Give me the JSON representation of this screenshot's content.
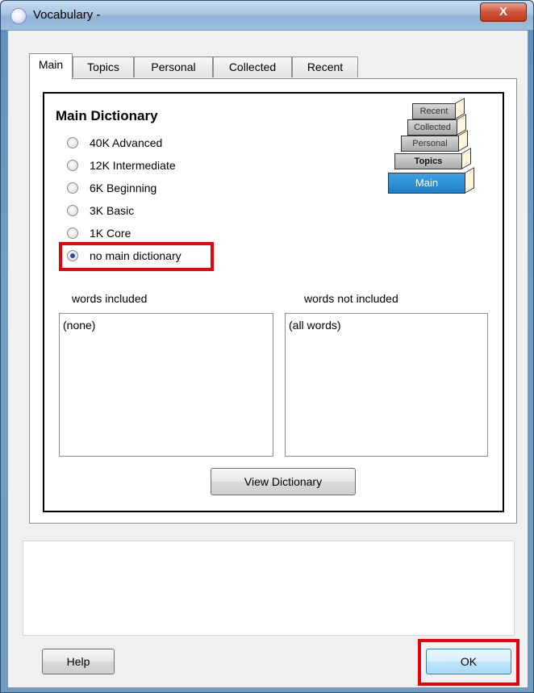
{
  "window": {
    "title": "Vocabulary -",
    "close_glyph": "X"
  },
  "tabs": [
    {
      "label": "Main",
      "active": true
    },
    {
      "label": "Topics",
      "active": false
    },
    {
      "label": "Personal",
      "active": false
    },
    {
      "label": "Collected",
      "active": false
    },
    {
      "label": "Recent",
      "active": false
    }
  ],
  "main": {
    "heading": "Main Dictionary",
    "options": [
      {
        "label": "40K Advanced",
        "checked": false
      },
      {
        "label": "12K Intermediate",
        "checked": false
      },
      {
        "label": "6K Beginning",
        "checked": false
      },
      {
        "label": "3K Basic",
        "checked": false
      },
      {
        "label": "1K Core",
        "checked": false
      },
      {
        "label": "no main dictionary",
        "checked": true
      }
    ],
    "books": [
      "Recent",
      "Collected",
      "Personal",
      "Topics",
      "Main"
    ],
    "included_label": "words included",
    "included_value": "(none)",
    "not_included_label": "words not included",
    "not_included_value": "(all words)",
    "view_button": "View Dictionary"
  },
  "footer": {
    "help_button": "Help",
    "ok_button": "OK"
  },
  "colors": {
    "highlight": "#e8000b",
    "main_book": "#1f7ec6"
  },
  "icons": {
    "app": "app-icon",
    "close": "close-icon",
    "books": "books-stack-icon"
  }
}
